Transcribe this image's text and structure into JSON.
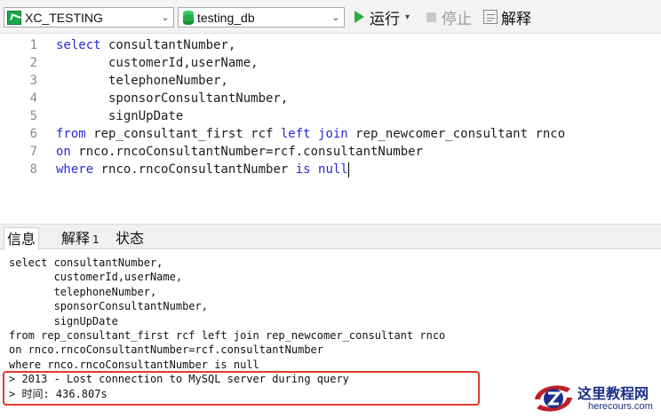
{
  "toolbar": {
    "connection": "XC_TESTING",
    "database": "testing_db",
    "run_label": "运行",
    "stop_label": "停止",
    "explain_label": "解释"
  },
  "editor": {
    "lines": [
      {
        "num": "1",
        "parts": [
          {
            "t": "select",
            "kw": true
          },
          {
            "t": " consultantNumber,"
          }
        ]
      },
      {
        "num": "2",
        "parts": [
          {
            "t": "       customerId,userName,"
          }
        ]
      },
      {
        "num": "3",
        "parts": [
          {
            "t": "       telephoneNumber,"
          }
        ]
      },
      {
        "num": "4",
        "parts": [
          {
            "t": "       sponsorConsultantNumber,"
          }
        ]
      },
      {
        "num": "5",
        "parts": [
          {
            "t": "       signUpDate"
          }
        ]
      },
      {
        "num": "6",
        "parts": [
          {
            "t": "from",
            "kw": true
          },
          {
            "t": " rep_consultant_first rcf "
          },
          {
            "t": "left join",
            "kw": true
          },
          {
            "t": " rep_newcomer_consultant rnco"
          }
        ]
      },
      {
        "num": "7",
        "parts": [
          {
            "t": "on",
            "kw": true
          },
          {
            "t": " rnco.rncoConsultantNumber=rcf.consultantNumber"
          }
        ]
      },
      {
        "num": "8",
        "parts": [
          {
            "t": "where",
            "kw": true
          },
          {
            "t": " rnco.rncoConsultantNumber "
          },
          {
            "t": "is null",
            "kw": true
          }
        ]
      }
    ]
  },
  "tabs": {
    "info": "信息",
    "explain": "解释",
    "explain_badge": "1",
    "status": "状态"
  },
  "output": {
    "lines": [
      "select consultantNumber,",
      "       customerId,userName,",
      "       telephoneNumber,",
      "       sponsorConsultantNumber,",
      "       signUpDate",
      "from rep_consultant_first rcf left join rep_newcomer_consultant rnco",
      "on rnco.rncoConsultantNumber=rcf.consultantNumber",
      "where rnco.rncoConsultantNumber is null",
      "> 2013 - Lost connection to MySQL server during query",
      "> 时间: 436.807s"
    ]
  },
  "watermark": {
    "title": "这里教程网",
    "url": "herecours.com"
  },
  "colors": {
    "keyword": "#2a2ad8",
    "run": "#2bae3f",
    "error_box": "#e03b2e",
    "watermark": "#1b2f8a"
  }
}
